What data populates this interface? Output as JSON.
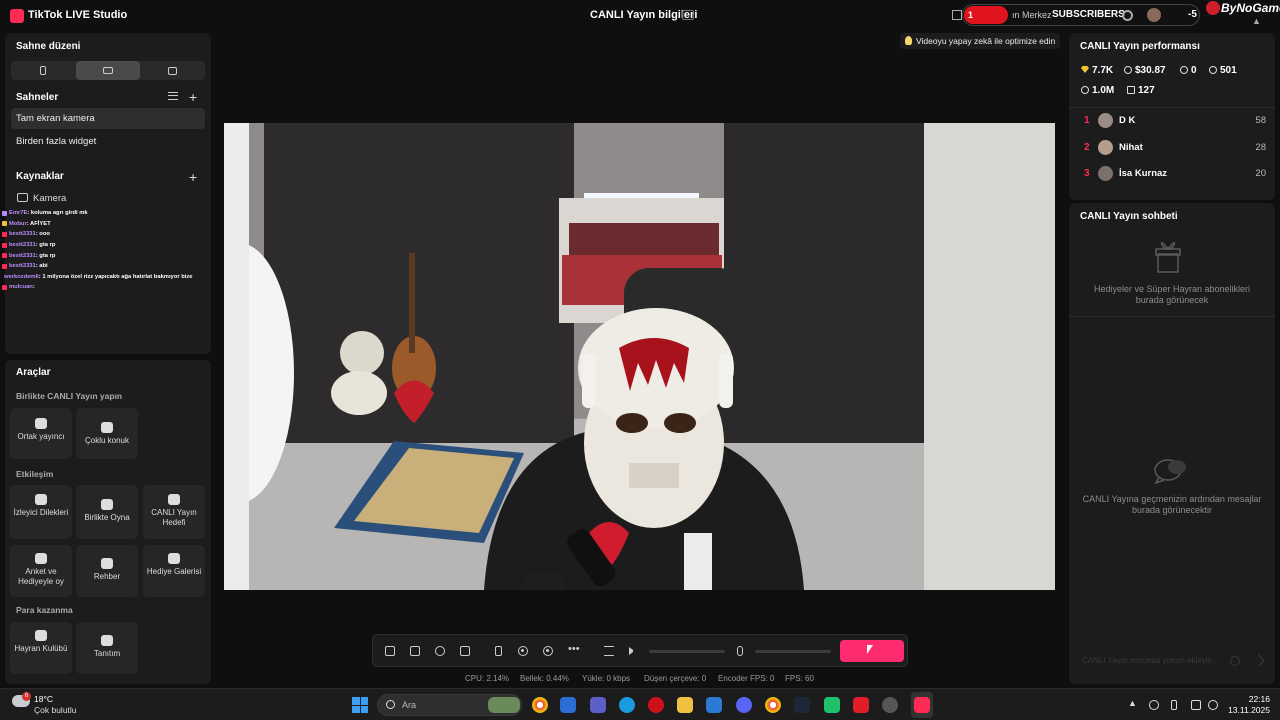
{
  "titlebar": {
    "app_title": "TikTok LIVE Studio",
    "center_title": "CANLI Yayın bilgileri",
    "overlay": {
      "count": "1",
      "merkez": "ın Merkez",
      "subscribers": "SUBSCRIBERS",
      "minus_value": "-5"
    },
    "brand": "ByNoGame"
  },
  "left": {
    "scene_layout_title": "Sahne düzeni",
    "scenes_title": "Sahneler",
    "scenes": [
      {
        "label": "Tam ekran kamera",
        "active": true
      },
      {
        "label": "Birden fazla widget",
        "active": false
      }
    ],
    "sources_title": "Kaynaklar",
    "sources": [
      {
        "label": "Kamera"
      }
    ],
    "chat_overlay": [
      {
        "user": "Emr7E",
        "msg": ": koluma agrı girdi mk",
        "badge": "#b98cff"
      },
      {
        "user": "Mobur",
        "msg": ": AFİYET",
        "badge": "#f2c230"
      },
      {
        "user": "bestt2331",
        "msg": ": ooo",
        "badge": "#fe2c55"
      },
      {
        "user": "bestt2331",
        "msg": ": gta rp",
        "badge": "#fe2c55"
      },
      {
        "user": "bestt2331",
        "msg": ": gta rp",
        "badge": "#fe2c55"
      },
      {
        "user": "bestt2331",
        "msg": ": abi",
        "badge": "#fe2c55"
      },
      {
        "user": "werkozdemli",
        "msg": ": 1 milyona özel rizz yapıcaktı ağa hatırlat bakmıyor bize",
        "badge": ""
      },
      {
        "user": "mulcuan",
        "msg": ":",
        "badge": "#fe2c55"
      }
    ],
    "tools_title": "Araçlar",
    "together_title": "Birlikte CANLI Yayın yapın",
    "together_tools": [
      "Ortak yayıncı",
      "Çoklu konuk"
    ],
    "interaction_title": "Etkileşim",
    "interaction_tools": [
      "İzleyici Dilekleri",
      "Birlikte Oyna",
      "CANLI Yayın Hedefi",
      "Anket ve Hediyeyle oy",
      "Rehber",
      "Hediye Galerisi"
    ],
    "earn_title": "Para kazanma",
    "earn_tools": [
      "Hayran Kulübü",
      "Tanıtım"
    ]
  },
  "preview": {
    "optimize_hint": "Videoyu yapay zekâ ile optimize edin"
  },
  "stats": {
    "cpu": "CPU:  2.14%",
    "memory": "Bellek:  0.44%",
    "upload": "Yükle:  0 kbps",
    "dropped": "Düşen çerçeve:  0",
    "encoder": "Encoder FPS:  0",
    "fps": "FPS:  60"
  },
  "right": {
    "performance_title": "CANLI Yayın performansı",
    "metrics": {
      "diamonds": "7.7K",
      "earnings": "$30.87",
      "viewers": "0",
      "followers": "501",
      "likes": "1.0M",
      "gifts": "127"
    },
    "ranking": [
      {
        "rank": "1",
        "name": "D K",
        "score": "58"
      },
      {
        "rank": "2",
        "name": "Nihat",
        "score": "28"
      },
      {
        "rank": "3",
        "name": "İsa Kurnaz",
        "score": "20"
      }
    ],
    "chat_title": "CANLI Yayın sohbeti",
    "gifts_empty": "Hediyeler ve Süper Hayran abonelikleri burada görünecek",
    "chat_empty": "CANLI Yayına geçmenizin ardından mesajlar burada görünecektir",
    "chat_input_placeholder": "CANLI Yayın sonunda yorum ekleyin"
  },
  "taskbar": {
    "weather_temp": "18°C",
    "weather_desc": "Çok bulutlu",
    "weather_badge": "6",
    "search_placeholder": "Ara",
    "time": "22:16",
    "date": "13.11.2025"
  },
  "colors": {
    "accent": "#fe2c55",
    "go_live": "#fe2c6e",
    "panel": "#1c1c1c",
    "background": "#0f0f0f"
  }
}
